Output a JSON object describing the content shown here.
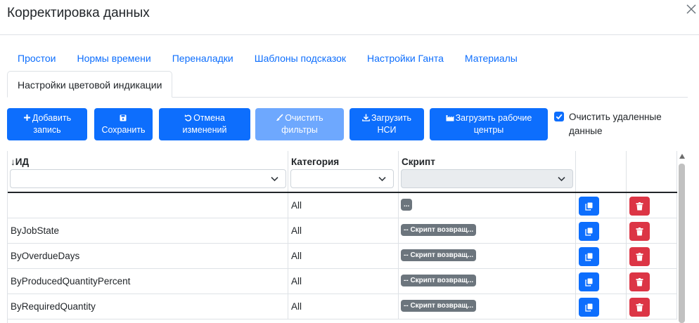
{
  "title": "Корректировка данных",
  "tabs": {
    "row1": [
      "Простои",
      "Нормы времени",
      "Переналадки",
      "Шаблоны подсказок",
      "Настройки Ганта",
      "Материалы"
    ],
    "active": "Настройки цветовой индикации"
  },
  "toolbar": {
    "add": [
      "Добавить",
      "запись"
    ],
    "save": [
      "",
      "Сохранить"
    ],
    "undo": [
      "Отмена",
      "изменений"
    ],
    "clear_filters": [
      "Очистить",
      "фильтры"
    ],
    "load_nsi": [
      "Загрузить",
      "НСИ"
    ],
    "load_centers": [
      "Загрузить рабочие",
      "центры"
    ],
    "clear_deleted": "Очистить удаленные данные",
    "clear_deleted_checked": true
  },
  "columns": {
    "id": "↓ИД",
    "category": "Категория",
    "script": "Скрипт"
  },
  "rows": [
    {
      "id": "",
      "category": "All",
      "script": "..."
    },
    {
      "id": "ByJobState",
      "category": "All",
      "script": "-- Скрипт возвращ..."
    },
    {
      "id": "ByOverdueDays",
      "category": "All",
      "script": "-- Скрипт возвращ..."
    },
    {
      "id": "ByProducedQuantityPercent",
      "category": "All",
      "script": "-- Скрипт возвращ..."
    },
    {
      "id": "ByRequiredQuantity",
      "category": "All",
      "script": "-- Скрипт возвращ..."
    }
  ],
  "colors": {
    "primary": "#0d6efd",
    "primary_disabled": "#6ea8fe",
    "danger": "#dc3545",
    "secondary": "#6c757d"
  }
}
